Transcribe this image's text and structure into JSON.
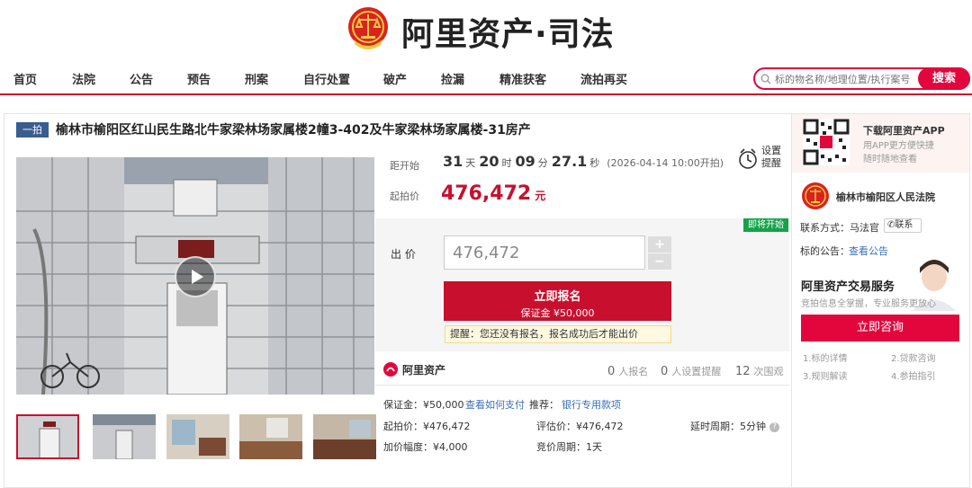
{
  "header": {
    "brand": "阿里资产·司法",
    "logo_icon": "court-emblem-icon"
  },
  "nav": {
    "items": [
      "首页",
      "法院",
      "公告",
      "预告",
      "刑案",
      "自行处置",
      "破产",
      "捡漏",
      "精准获客",
      "流拍再买"
    ],
    "search_placeholder": "标的物名称/地理位置/执行案号",
    "search_label": "搜索"
  },
  "listing": {
    "tag": "一拍",
    "title": "榆林市榆阳区红山民生路北牛家梁林场家属楼2幢3-402及牛家梁林场家属楼-31房产"
  },
  "auction": {
    "countdown_label": "距开始",
    "days": "31",
    "days_unit": "天",
    "hours": "20",
    "hours_unit": "时",
    "minutes": "09",
    "minutes_unit": "分",
    "seconds": "27.1",
    "seconds_unit": "秒",
    "start_note": "(2026-04-14 10:00开拍)",
    "start_price_label": "起拍价",
    "start_price": "476,472",
    "start_price_unit": "元",
    "reminder_label_1": "设置",
    "reminder_label_2": "提醒",
    "status_badge": "即将开始",
    "bid_label": "出 价",
    "bid_value": "476,472",
    "plus": "+",
    "minus": "−",
    "signup_label": "立即报名",
    "deposit_label": "保证金 ¥50,000",
    "hint": "提醒：您还没有报名，报名成功后才能出价"
  },
  "stats": {
    "brand": "阿里资产",
    "signups_num": "0",
    "signups_label": "人报名",
    "reminders_num": "0",
    "reminders_label": "人设置提醒",
    "views_num": "12",
    "views_label": "次围观"
  },
  "details": {
    "deposit": "保证金：¥50,000",
    "pay_link": "查看如何支付",
    "recommend_label": "推荐：",
    "recommend_link": "银行专用款项",
    "start_price": "起拍价：¥476,472",
    "appraisal": "评估价：¥476,472",
    "delay": "延时周期：5分钟",
    "increment": "加价幅度：¥4,000",
    "bid_cycle": "竞价周期：1天"
  },
  "sidebar": {
    "app_title": "下载阿里资产APP",
    "app_sub_1": "用APP更方便快捷",
    "app_sub_2": "随时随地查看",
    "court_name": "榆林市榆阳区人民法院",
    "contact_label": "联系方式：马法官",
    "contact_button": "联系",
    "notice_label": "标的公告：",
    "notice_link": "查看公告",
    "service_title": "阿里资产交易服务",
    "service_sub": "竞拍信息全掌握，专业服务更放心",
    "consult_button": "立即咨询",
    "guide_1": "1.标的详情",
    "guide_2": "2.贷款咨询",
    "guide_3": "3.规则解读",
    "guide_4": "4.参拍指引"
  },
  "colors": {
    "brand_red": "#c8102e",
    "search_red": "#e2063d",
    "link_blue": "#3a6fb6",
    "status_green": "#14a24a",
    "tag_blue": "#3a5d8f"
  }
}
